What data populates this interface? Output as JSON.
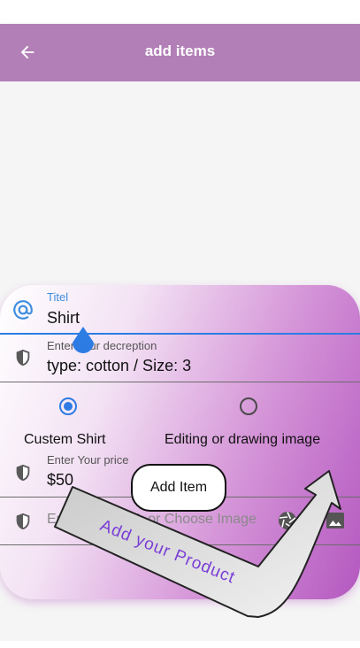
{
  "appbar": {
    "title": "add items"
  },
  "form": {
    "title_field": {
      "label": "Titel",
      "value": "Shirt"
    },
    "description_field": {
      "label": "Enter your decreption",
      "value": "type: cotton / Size: 3"
    },
    "type_options": [
      {
        "label": "Custem Shirt",
        "selected": true
      },
      {
        "label": "Editing or drawing image",
        "selected": false
      }
    ],
    "price_field": {
      "label": "Enter Your price",
      "value": "$50"
    },
    "url_field": {
      "placeholder": "Enter your URL or Choose Image"
    },
    "add_button_label": "Add Item"
  },
  "annotation": {
    "text": "Add your Product"
  },
  "colors": {
    "appbar": "#b27fb6",
    "accent": "#2d7ce3",
    "card_gradient_end": "#b458c0",
    "annotation_text": "#7b3ed6"
  },
  "icons": [
    "back-arrow-icon",
    "at-sign-icon",
    "shield-icon",
    "camera-icon",
    "image-icon"
  ]
}
